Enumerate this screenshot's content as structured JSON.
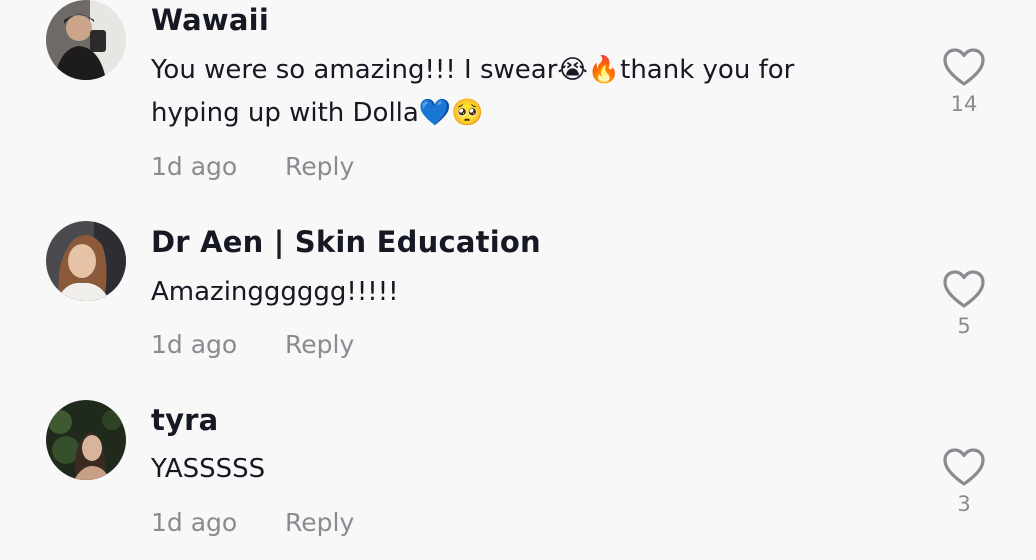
{
  "comments": [
    {
      "username": "Wawaii",
      "text": "You were so amazing!!! I swear😭🔥thank you for hyping up with Dolla💙🥺",
      "time": "1d ago",
      "reply_label": "Reply",
      "likes": "14",
      "avatar_icon": "avatar-photo"
    },
    {
      "username": "Dr Aen | Skin Education",
      "text": "Amazingggggg!!!!!",
      "time": "1d ago",
      "reply_label": "Reply",
      "likes": "5",
      "avatar_icon": "avatar-photo"
    },
    {
      "username": "tyra",
      "text": "YASSSSS",
      "time": "1d ago",
      "reply_label": "Reply",
      "likes": "3",
      "avatar_icon": "avatar-photo"
    }
  ],
  "icons": {
    "like": "heart-outline-icon"
  },
  "colors": {
    "text_primary": "#161823",
    "text_secondary": "#8a8b91",
    "background": "#f8f8f8"
  }
}
